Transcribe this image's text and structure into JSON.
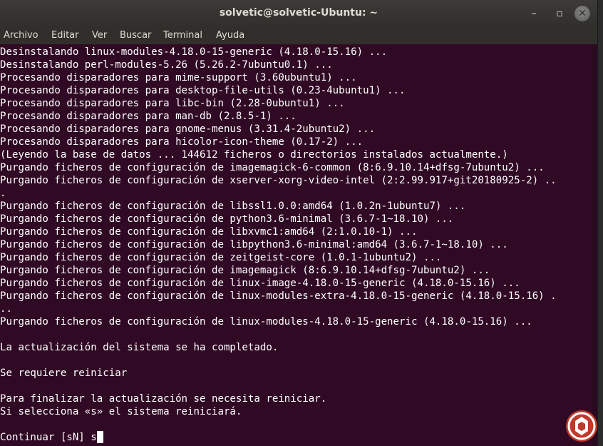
{
  "window": {
    "title": "solvetic@solvetic-Ubuntu: ~",
    "minimize_glyph": "–",
    "maximize_glyph": "▫",
    "close_glyph": "✕"
  },
  "menu": {
    "items": [
      "Archivo",
      "Editar",
      "Ver",
      "Buscar",
      "Terminal",
      "Ayuda"
    ]
  },
  "terminal": {
    "lines": [
      "Desinstalando linux-modules-4.18.0-15-generic (4.18.0-15.16) ...",
      "Desinstalando perl-modules-5.26 (5.26.2-7ubuntu0.1) ...",
      "Procesando disparadores para mime-support (3.60ubuntu1) ...",
      "Procesando disparadores para desktop-file-utils (0.23-4ubuntu1) ...",
      "Procesando disparadores para libc-bin (2.28-0ubuntu1) ...",
      "Procesando disparadores para man-db (2.8.5-1) ...",
      "Procesando disparadores para gnome-menus (3.31.4-2ubuntu2) ...",
      "Procesando disparadores para hicolor-icon-theme (0.17-2) ...",
      "(Leyendo la base de datos ... 144612 ficheros o directorios instalados actualmente.)",
      "Purgando ficheros de configuración de imagemagick-6-common (8:6.9.10.14+dfsg-7ubuntu2) ...",
      "Purgando ficheros de configuración de xserver-xorg-video-intel (2:2.99.917+git20180925-2) ..",
      ".",
      "Purgando ficheros de configuración de libssl1.0.0:amd64 (1.0.2n-1ubuntu7) ...",
      "Purgando ficheros de configuración de python3.6-minimal (3.6.7-1~18.10) ...",
      "Purgando ficheros de configuración de libxvmc1:amd64 (2:1.0.10-1) ...",
      "Purgando ficheros de configuración de libpython3.6-minimal:amd64 (3.6.7-1~18.10) ...",
      "Purgando ficheros de configuración de zeitgeist-core (1.0.1-1ubuntu2) ...",
      "Purgando ficheros de configuración de imagemagick (8:6.9.10.14+dfsg-7ubuntu2) ...",
      "Purgando ficheros de configuración de linux-image-4.18.0-15-generic (4.18.0-15.16) ...",
      "Purgando ficheros de configuración de linux-modules-extra-4.18.0-15-generic (4.18.0-15.16) .",
      "..",
      "Purgando ficheros de configuración de linux-modules-4.18.0-15-generic (4.18.0-15.16) ...",
      "",
      "La actualización del sistema se ha completado.",
      "",
      "Se requiere reiniciar",
      "",
      "Para finalizar la actualización se necesita reiniciar.",
      "Si selecciona «s» el sistema reiniciará.",
      ""
    ],
    "prompt": "Continuar [sN] s"
  },
  "colors": {
    "terminal_background": "#300a24",
    "terminal_text": "#ffffff",
    "titlebar": "#3c3b37"
  },
  "icons": {
    "watermark": "solvetic-logo-icon"
  }
}
